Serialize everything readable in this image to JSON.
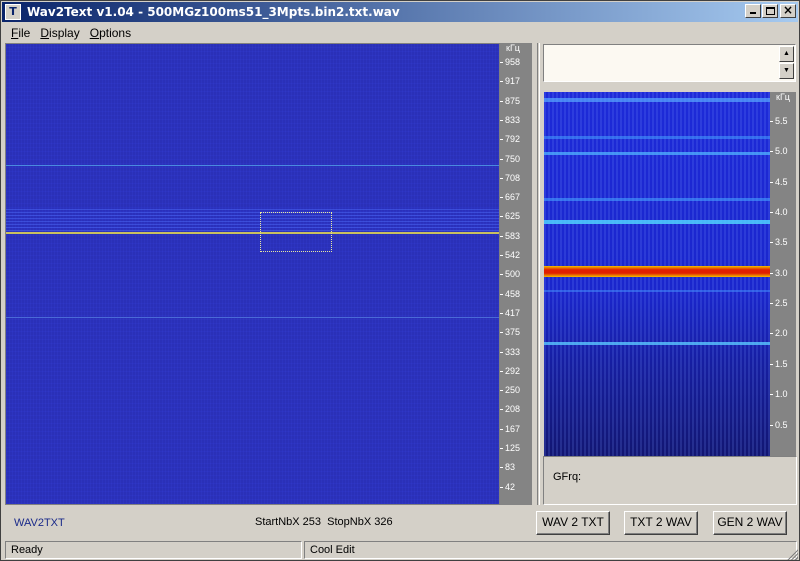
{
  "window": {
    "icon_letter": "T",
    "title": "Wav2Text v1.04 - 500MGz100ms51_3Mpts.bin2.txt.wav"
  },
  "menu": {
    "file": "File",
    "display": "Display",
    "options": "Options"
  },
  "main_axis": {
    "unit": "кГц",
    "ticks": [
      "958",
      "917",
      "875",
      "833",
      "792",
      "750",
      "708",
      "667",
      "625",
      "583",
      "542",
      "500",
      "458",
      "417",
      "375",
      "333",
      "292",
      "250",
      "208",
      "167",
      "125",
      "83",
      "42"
    ]
  },
  "sono_axis": {
    "unit": "кГц",
    "ticks": [
      "5.5",
      "5.0",
      "4.5",
      "4.0",
      "3.5",
      "3.0",
      "2.5",
      "2.0",
      "1.5",
      "1.0",
      "0.5"
    ]
  },
  "gfrq": {
    "label": "GFrq:"
  },
  "bottom": {
    "mode": "WAV2TXT",
    "nbx": "StartNbX 253  StopNbX 326",
    "btn_wav2txt": "WAV 2 TXT",
    "btn_txt2wav": "TXT 2 WAV",
    "btn_gen2wav": "GEN 2 WAV"
  },
  "status": {
    "left": "Ready",
    "right": "Cool Edit"
  },
  "colors": {
    "spectrogram_bg": "#2a30b8",
    "signal_line": "#c8c060",
    "sono_peak": "#f0a000"
  }
}
